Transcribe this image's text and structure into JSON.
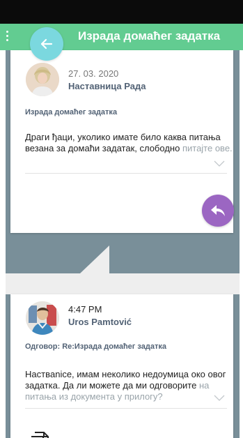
{
  "header": {
    "title": "Израда домаћег задатка",
    "menu_icon": "more-vertical-icon",
    "back_icon": "arrow-left-icon"
  },
  "colors": {
    "header": "#62cc91",
    "back_button": "#7bd8df",
    "reply_button": "#9b66c2",
    "background": "#798f99"
  },
  "teacher_message": {
    "date": "27. 03. 2020",
    "author": "Наставница Рада",
    "subject": "Израда домаћег задатка",
    "text": "Драги ђаци, уколико имате било каква питања везана за домаћи задатак, слободно",
    "text_faded": "питајте ове.",
    "reply_icon": "reply-icon",
    "expand_icon": "chevron-down-icon"
  },
  "student_reply": {
    "time": "4:47 PM",
    "author": "Uros Pamtović",
    "subject": "Одговор: Re:Израда домаћег задатка",
    "text": "Наствanice, имам неколико недоумица око овог задатка. Да ли можете да ми одговорите",
    "text_faded": "на питања из документа у прилогу?",
    "expand_icon": "chevron-down-icon",
    "attachment_icon": "document-icon"
  }
}
